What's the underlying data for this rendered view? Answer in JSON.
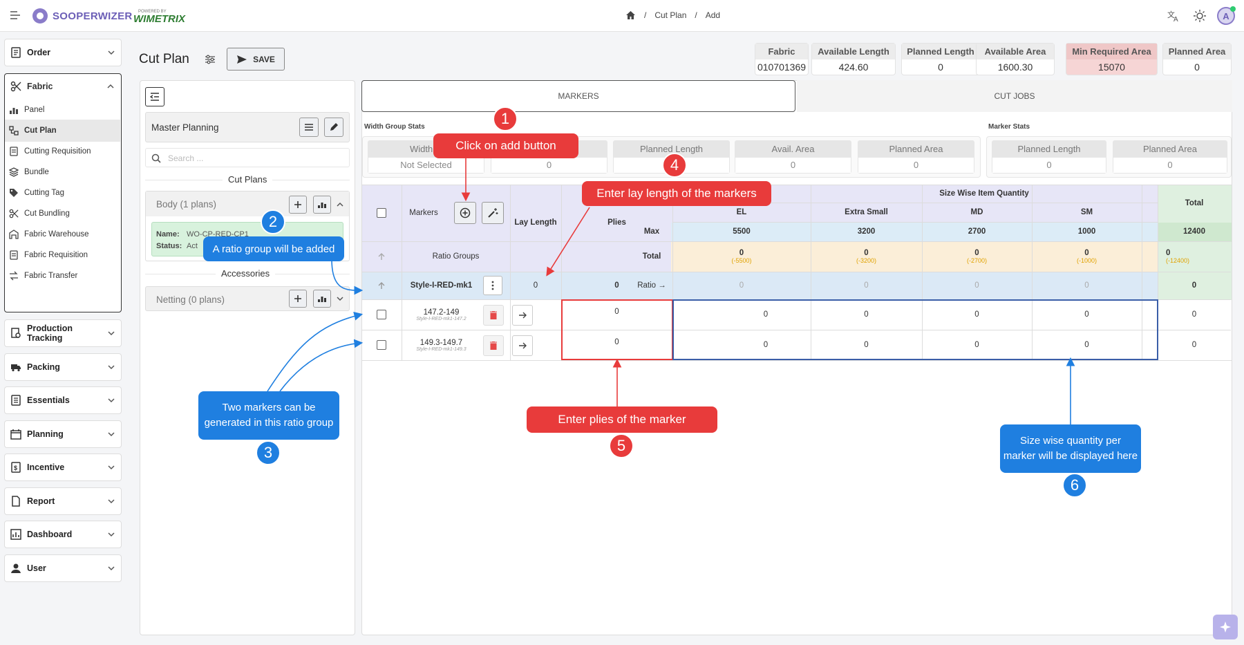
{
  "brand": {
    "name": "SOOPERWIZER",
    "powered_by": "POWERED BY",
    "partner": "WIMETRIX"
  },
  "breadcrumb": {
    "items": [
      "Cut Plan",
      "Add"
    ],
    "separator": "/"
  },
  "avatar_letter": "A",
  "sidebar": {
    "groups": [
      {
        "label": "Order",
        "icon": "order-icon"
      },
      {
        "label": "Production Tracking",
        "icon": "production-icon"
      },
      {
        "label": "Packing",
        "icon": "truck-icon"
      },
      {
        "label": "Essentials",
        "icon": "essentials-icon"
      },
      {
        "label": "Planning",
        "icon": "calendar-icon"
      },
      {
        "label": "Incentive",
        "icon": "incentive-icon"
      },
      {
        "label": "Report",
        "icon": "report-icon"
      },
      {
        "label": "Dashboard",
        "icon": "dashboard-icon"
      },
      {
        "label": "User",
        "icon": "user-icon"
      }
    ],
    "fabric": {
      "label": "Fabric",
      "items": [
        "Panel",
        "Cut Plan",
        "Cutting Requisition",
        "Bundle",
        "Cutting Tag",
        "Cut Bundling",
        "Fabric Warehouse",
        "Fabric Requisition",
        "Fabric Transfer"
      ],
      "active": "Cut Plan"
    }
  },
  "page": {
    "title": "Cut Plan",
    "save_label": "SAVE"
  },
  "stats": [
    {
      "label": "Fabric",
      "value": "010701369"
    },
    {
      "label": "Available Length",
      "value": "424.60"
    },
    {
      "label": "Planned Length",
      "value": "0"
    },
    {
      "label": "Available Area",
      "value": "1600.30"
    },
    {
      "label": "Min Required Area",
      "value": "15070",
      "highlight": "#f6d5d5"
    },
    {
      "label": "Planned Area",
      "value": "0"
    }
  ],
  "left_panel": {
    "master_planning": "Master Planning",
    "search_placeholder": "Search ...",
    "cut_plans_heading": "Cut Plans",
    "body_group": "Body (1 plans)",
    "plan_name_label": "Name:",
    "plan_name": "WO-CP-RED-CP1",
    "plan_status_label": "Status:",
    "plan_status": "Act",
    "accessories_heading": "Accessories",
    "netting_group": "Netting (0 plans)"
  },
  "tabs": {
    "markers": "MARKERS",
    "cut_jobs": "CUT JOBS"
  },
  "width_group_stats": {
    "title": "Width Group Stats",
    "cells": [
      {
        "label": "Width G",
        "value": "Not Selected"
      },
      {
        "label": "",
        "value": "0"
      },
      {
        "label": "Planned Length",
        "value": ""
      },
      {
        "label": "Avail. Area",
        "value": "0"
      },
      {
        "label": "Planned Area",
        "value": "0"
      }
    ]
  },
  "marker_stats": {
    "title": "Marker Stats",
    "cells": [
      {
        "label": "Planned Length",
        "value": "0"
      },
      {
        "label": "Planned Area",
        "value": "0"
      }
    ]
  },
  "table": {
    "markers_label": "Markers",
    "lay_length_label": "Lay Length",
    "plies_label": "Plies",
    "size_wise_label": "Size Wise Item Quantity",
    "total_label": "Total",
    "sizes": [
      "EL",
      "Extra Small",
      "MD",
      "SM"
    ],
    "max_label": "Max",
    "max_values": [
      "5500",
      "3200",
      "2700",
      "1000"
    ],
    "max_total": "12400",
    "total_row_label": "Total",
    "total_values": [
      "0",
      "0",
      "0",
      "0"
    ],
    "total_deltas": [
      "(-5500)",
      "(-3200)",
      "(-2700)",
      "(-1000)"
    ],
    "total_total": "0",
    "total_total_delta": "(-12400)",
    "ratio_groups_label": "Ratio Groups",
    "ratio_group": {
      "name": "Style-I-RED-mk1",
      "lay_length": "0",
      "plies": "0",
      "ratio_label": "Ratio →",
      "sizes": [
        "0",
        "0",
        "0",
        "0"
      ],
      "total": "0"
    },
    "markers": [
      {
        "name": "147.2-149",
        "sub": "Style-I-RED-mk1-147.2",
        "plies": "0",
        "sizes": [
          "0",
          "0",
          "0",
          "0"
        ],
        "total": "0"
      },
      {
        "name": "149.3-149.7",
        "sub": "Style-I-RED-mk1-149.3",
        "plies": "0",
        "sizes": [
          "0",
          "0",
          "0",
          "0"
        ],
        "total": "0"
      }
    ]
  },
  "annotations": {
    "a1": {
      "number": "1",
      "text": "Click on add button"
    },
    "a2": {
      "number": "2",
      "text": "A ratio group will be added"
    },
    "a3": {
      "number": "3",
      "text": "Two markers can be generated in this ratio group"
    },
    "a4": {
      "number": "4",
      "text": "Enter lay length of the markers"
    },
    "a5": {
      "number": "5",
      "text": "Enter plies of the marker"
    },
    "a6": {
      "number": "6",
      "text": "Size wise quantity per marker will be displayed here"
    }
  },
  "colors": {
    "annotation_red": "#e83b3b",
    "annotation_blue": "#1f7fe0",
    "max_row_bg": "#dcecf7",
    "total_row_bg": "#fbeed8",
    "ratio_row_bg": "#dbe9f6",
    "header_bg": "#e7e6f7",
    "status_green_bg": "#d8f2dd"
  }
}
